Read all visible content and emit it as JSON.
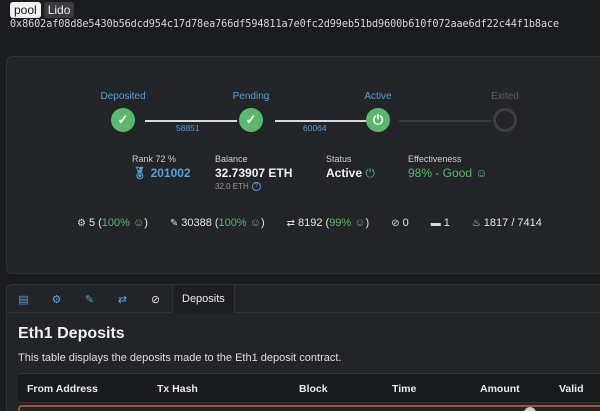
{
  "tags": {
    "pool": "pool",
    "lido": "Lido"
  },
  "address": "0x8602af08d8e5430b56dcd954c17d78ea766df594811a7e0fc2d99eb51bd9600b610f072aae6df22c44f1b8ace",
  "timeline": {
    "stages": [
      {
        "label": "Deposited",
        "icon": "check-icon"
      },
      {
        "label": "Pending",
        "icon": "check-icon"
      },
      {
        "label": "Active",
        "icon": "power-icon"
      },
      {
        "label": "Exited",
        "icon": "ring-icon"
      }
    ],
    "epochs": [
      "58851",
      "60064"
    ]
  },
  "stats": {
    "rank": {
      "label": "Rank 72 %",
      "value": "201002",
      "icon": "medal-icon"
    },
    "balance": {
      "label": "Balance",
      "value": "32.73907 ETH",
      "sub": "32.0 ETH"
    },
    "status": {
      "label": "Status",
      "value": "Active"
    },
    "effectiveness": {
      "label": "Effectiveness",
      "value": "98% - Good"
    }
  },
  "metrics": [
    {
      "icon": "proposals-icon",
      "value": "5",
      "pct": "100%"
    },
    {
      "icon": "attestations-icon",
      "value": "30388",
      "pct": "100%"
    },
    {
      "icon": "sync-icon",
      "value": "8192",
      "pct": "99%"
    },
    {
      "icon": "slashing-icon",
      "value": "0"
    },
    {
      "icon": "deposits-icon",
      "value": "1"
    },
    {
      "icon": "fire-icon",
      "value": "1817 / 7414"
    }
  ],
  "tabs": {
    "active_label": "Deposits"
  },
  "deposits": {
    "title": "Eth1 Deposits",
    "description": "This table displays the deposits made to the Eth1 deposit contract.",
    "columns": [
      "From Address",
      "Tx Hash",
      "Block",
      "Time",
      "Amount",
      "Valid"
    ]
  },
  "colors": {
    "accent": "#4ea3dc",
    "success": "#5ab86d",
    "highlight": "#b04a36"
  }
}
